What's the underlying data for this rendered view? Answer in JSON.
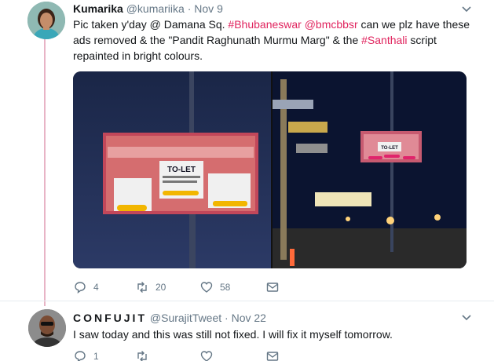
{
  "tweets": [
    {
      "name": "Kumarika",
      "handle": "@kumariika",
      "time": "Nov 9",
      "text_parts": [
        {
          "t": "Pic taken y'day @ Damana Sq. ",
          "kind": "text"
        },
        {
          "t": "#Bhubaneswar",
          "kind": "tag"
        },
        {
          "t": " ",
          "kind": "text"
        },
        {
          "t": "@bmcbbsr",
          "kind": "mention"
        },
        {
          "t": " can we plz have these ads removed & the \"Pandit Raghunath Murmu Marg\" & the ",
          "kind": "text"
        },
        {
          "t": "#Santhali",
          "kind": "tag"
        },
        {
          "t": " script repainted in bright colours.",
          "kind": "text"
        }
      ],
      "photo1_sign_text": "TO-LET",
      "photo2_sign_text": "TO-LET",
      "replies": "4",
      "retweets": "20",
      "likes": "58"
    },
    {
      "name": "CONFUJIT",
      "handle": "@SurajitTweet",
      "time": "Nov 22",
      "text": "I saw today and this was still not fixed. I will fix it myself tomorrow.",
      "replies": "1",
      "retweets": "",
      "likes": ""
    }
  ],
  "icons": {
    "reply": "reply-icon",
    "retweet": "retweet-icon",
    "like": "heart-icon",
    "dm": "mail-icon",
    "more": "chevron-down-icon"
  },
  "colors": {
    "hashtag": "#e0245e",
    "thread_line": "#e8b4c6",
    "muted": "#657786"
  }
}
